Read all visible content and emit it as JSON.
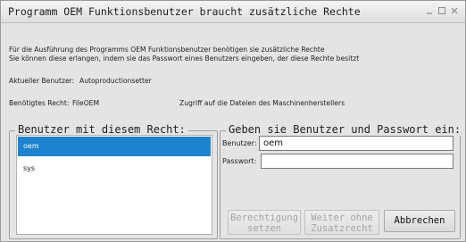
{
  "window": {
    "title": "Programm OEM Funktionsbenutzer braucht zusätzliche Rechte"
  },
  "info": {
    "line1": "Für die Ausführung des Programms OEM Funktionsbenutzer benötigen sie zusätzliche Rechte",
    "line2": "Sie können diese erlangen, indem sie das Passwort eines Benutzers eingeben, der diese Rechte besitzt",
    "current_user_label": "Aktueller Benutzer:",
    "current_user_value": "Autoproductionsetter",
    "required_right_label": "Benötigtes Recht:",
    "required_right_value": "FileOEM",
    "required_right_description": "Zugriff auf die Dateien des Maschinenherstellers"
  },
  "users_panel": {
    "title": "Benutzer mit diesem Recht:",
    "users": [
      {
        "name": "oem",
        "selected": true
      },
      {
        "name": "sys",
        "selected": false
      }
    ]
  },
  "login_panel": {
    "title": "Geben sie Benutzer und Passwort ein:",
    "user_label": "Benutzer:",
    "user_value": "oem",
    "password_label": "Passwort:",
    "password_value": ""
  },
  "buttons": {
    "authorize_line1": "Berechtigung",
    "authorize_line2": "setzen",
    "continue_line1": "Weiter ohne",
    "continue_line2": "Zusatzrecht",
    "cancel": "Abbrechen"
  }
}
